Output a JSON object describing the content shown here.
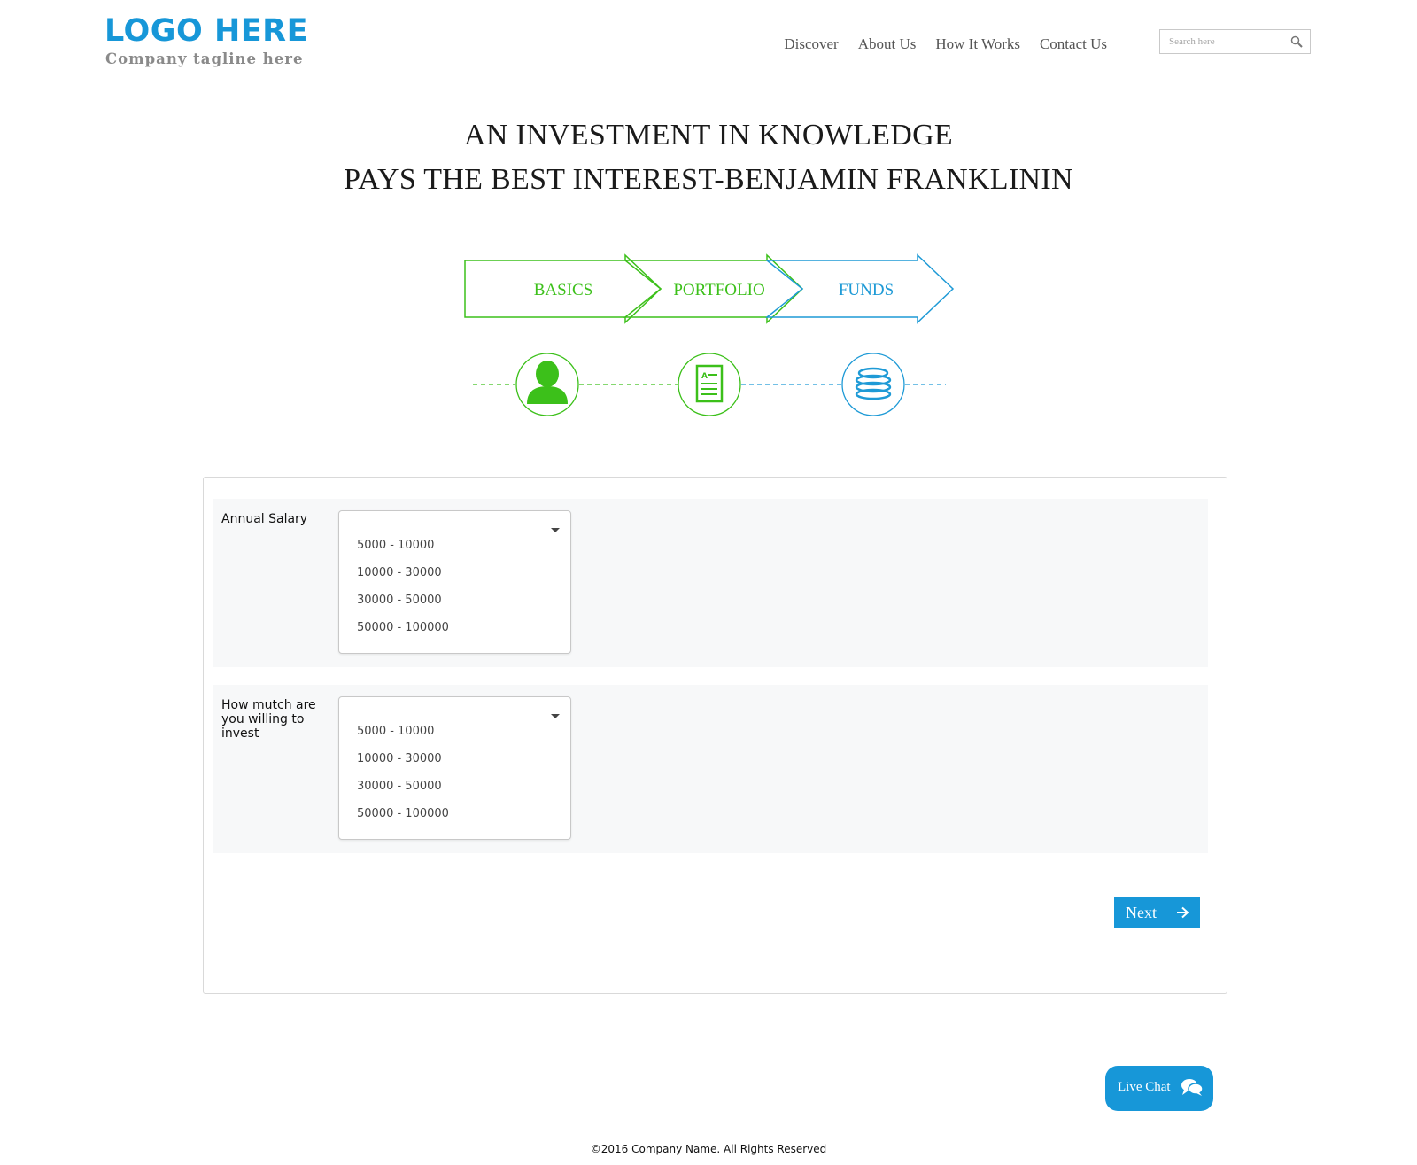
{
  "header": {
    "logo": "LOGO HERE",
    "tagline": "Company tagline here",
    "nav": [
      "Discover",
      "About Us",
      "How It Works",
      "Contact Us"
    ],
    "search_placeholder": "Search here"
  },
  "hero": {
    "quote_line1": "AN INVESTMENT IN KNOWLEDGE",
    "quote_line2": "PAYS THE BEST INTEREST-BENJAMIN FRANKLININ"
  },
  "steps": [
    {
      "label": "BASICS",
      "icon": "user-icon",
      "color": "#3cc01a"
    },
    {
      "label": "PORTFOLIO",
      "icon": "document-icon",
      "color": "#3cc01a"
    },
    {
      "label": "FUNDS",
      "icon": "coins-icon",
      "color": "#1e9ad6"
    }
  ],
  "form": {
    "rows": [
      {
        "label": "Annual Salary",
        "options": [
          "5000 - 10000",
          "10000 - 30000",
          "30000 - 50000",
          "50000 - 100000"
        ]
      },
      {
        "label": "How mutch are you willing to invest",
        "options": [
          "5000 - 10000",
          "10000 - 30000",
          "30000 - 50000",
          "50000 - 100000"
        ]
      }
    ],
    "next_label": "Next"
  },
  "livechat_label": "Live Chat",
  "footer": "©2016 Company Name. All Rights Reserved",
  "colors": {
    "accent": "#1797d8",
    "green": "#3cc01a"
  }
}
